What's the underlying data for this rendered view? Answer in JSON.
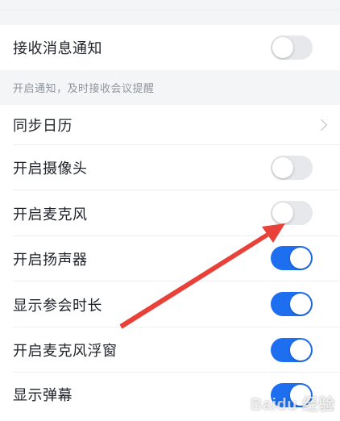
{
  "settings": {
    "receive_notifications": {
      "label": "接收消息通知",
      "enabled": false
    },
    "notification_hint": "开启通知，及时接收会议提醒",
    "sync_calendar": {
      "label": "同步日历"
    },
    "camera": {
      "label": "开启摄像头",
      "enabled": false
    },
    "microphone": {
      "label": "开启麦克风",
      "enabled": false
    },
    "speaker": {
      "label": "开启扬声器",
      "enabled": true
    },
    "show_duration": {
      "label": "显示参会时长",
      "enabled": true
    },
    "mic_floating": {
      "label": "开启麦克风浮窗",
      "enabled": true
    },
    "show_danmaku": {
      "label": "显示弹幕",
      "enabled": true
    }
  },
  "watermark": "Baidu 经验",
  "colors": {
    "toggle_on": "#1e6ff0",
    "toggle_off": "#e7e8eb",
    "annotation_arrow": "#e8413a"
  },
  "icons": {
    "chevron": "chevron-right-icon",
    "annotation": "red-arrow-annotation"
  }
}
